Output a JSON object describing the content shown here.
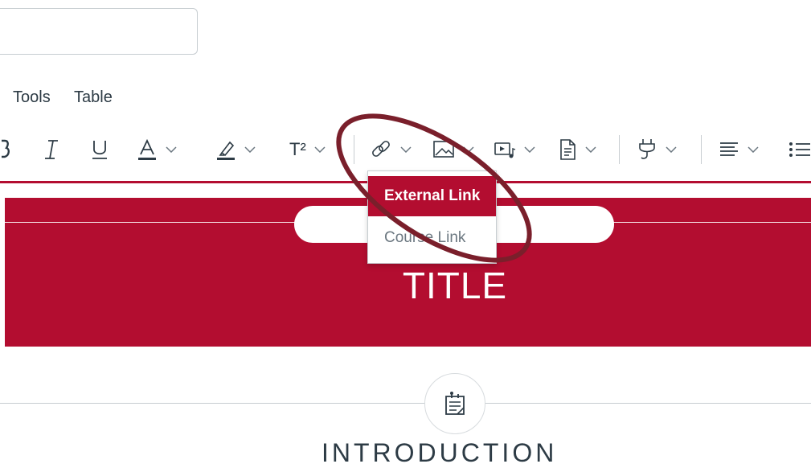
{
  "menubar": {
    "items": [
      "Tools",
      "Table"
    ]
  },
  "toolbar": {
    "superscript_label": "T²"
  },
  "banner": {
    "title": "TITLE"
  },
  "link_menu": {
    "items": [
      {
        "label": "External Link",
        "selected": true
      },
      {
        "label": "Course Link",
        "selected": false
      }
    ]
  },
  "section": {
    "heading": "INTRODUCTION"
  },
  "icons": [
    "bold-icon",
    "italic-icon",
    "underline-icon",
    "text-color-icon",
    "highlight-icon",
    "superscript-icon",
    "link-icon",
    "image-icon",
    "media-icon",
    "document-icon",
    "plugin-icon",
    "align-icon",
    "list-icon",
    "assignment-icon"
  ],
  "colors": {
    "accent": "#b30d30",
    "annotation": "#7a1f2b",
    "text": "#2d3b45"
  }
}
